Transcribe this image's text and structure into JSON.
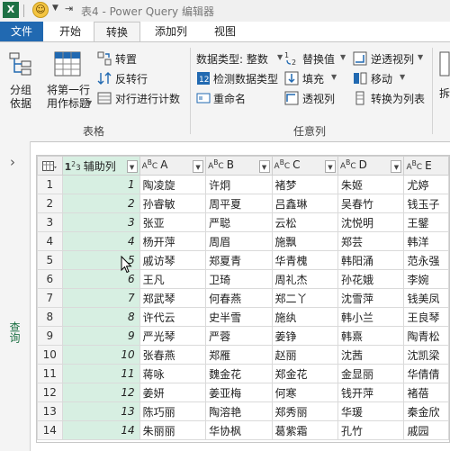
{
  "window": {
    "title": "表4 - Power Query 编辑器",
    "app_icon": "X"
  },
  "tabs": [
    "文件",
    "开始",
    "转换",
    "添加列",
    "视图"
  ],
  "ribbon": {
    "group_table": {
      "label": "表格",
      "group_by": "分组\n依据",
      "use_first_row": "将第一行\n用作标题",
      "transpose": "转置",
      "reverse_rows": "反转行",
      "count_rows": "对行进行计数"
    },
    "group_any_column": {
      "label": "任意列",
      "data_type": "数据类型: 整数",
      "detect_type": "检测数据类型",
      "rename": "重命名",
      "replace_values": "替换值",
      "fill": "填充",
      "pivot": "透视列",
      "unpivot": "逆透视列",
      "move": "移动",
      "convert_to_list": "转换为列表"
    },
    "partial": "拆"
  },
  "side_pane": {
    "label": "查询"
  },
  "grid": {
    "columns": [
      {
        "type": "123",
        "name": "辅助列"
      },
      {
        "type": "ABC",
        "name": "A"
      },
      {
        "type": "ABC",
        "name": "B"
      },
      {
        "type": "ABC",
        "name": "C"
      },
      {
        "type": "ABC",
        "name": "D"
      },
      {
        "type": "ABC",
        "name": "E"
      }
    ],
    "rows": [
      [
        "1",
        "陶凌旋",
        "许炯",
        "褚梦",
        "朱姬",
        "尤婷"
      ],
      [
        "2",
        "孙睿敏",
        "周平夏",
        "吕鑫琳",
        "吴春竹",
        "钱玉子"
      ],
      [
        "3",
        "张亚",
        "严聪",
        "云松",
        "沈悦明",
        "王鐾"
      ],
      [
        "4",
        "杨开萍",
        "周眉",
        "施飘",
        "郑芸",
        "韩洋"
      ],
      [
        "5",
        "戚访琴",
        "郑夏青",
        "华青槐",
        "韩阳涌",
        "范永强"
      ],
      [
        "6",
        "王凡",
        "卫琦",
        "周礼杰",
        "孙花娥",
        "李婉"
      ],
      [
        "7",
        "郑武琴",
        "何春燕",
        "郑二丫",
        "沈雪萍",
        "钱美凤"
      ],
      [
        "8",
        "许代云",
        "史半雪",
        "施纨",
        "韩小兰",
        "王良琴"
      ],
      [
        "9",
        "严光琴",
        "严蓉",
        "姜铮",
        "韩熹",
        "陶青松"
      ],
      [
        "10",
        "张春燕",
        "郑雁",
        "赵丽",
        "沈茜",
        "沈凯梁"
      ],
      [
        "11",
        "蒋咏",
        "魏金花",
        "郑金花",
        "金显丽",
        "华倩倩"
      ],
      [
        "12",
        "姜妍",
        "姜亚梅",
        "何寒",
        "钱开萍",
        "褚蓓"
      ],
      [
        "13",
        "陈巧丽",
        "陶溶艳",
        "郑秀丽",
        "华瑗",
        "秦金欣"
      ],
      [
        "14",
        "朱丽丽",
        "华协枫",
        "葛紫霜",
        "孔竹",
        "戚园"
      ]
    ]
  }
}
